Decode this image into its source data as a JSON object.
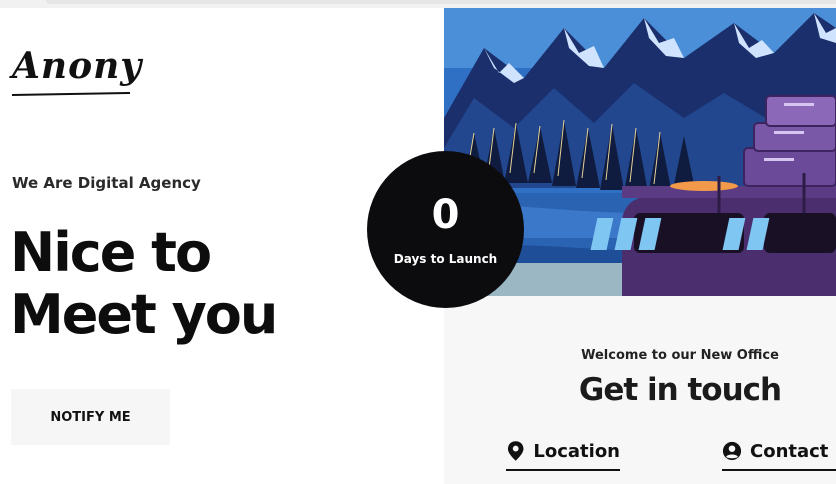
{
  "brand": {
    "logo_text": "Anony"
  },
  "hero": {
    "tagline": "We Are Digital Agency",
    "headline_line1": "Nice to",
    "headline_line2": "Meet you",
    "notify_label": "NOTIFY ME"
  },
  "countdown": {
    "value": "0",
    "label": "Days to Launch"
  },
  "contact_section": {
    "welcome": "Welcome to our New Office",
    "title": "Get in touch",
    "tabs": [
      {
        "label": "Location",
        "icon": "map-pin-icon"
      },
      {
        "label": "Contact",
        "icon": "user-circle-icon"
      }
    ]
  },
  "colors": {
    "dark": "#0c0c0f",
    "mountain_blue": "#1f3f8a",
    "sky": "#2f6fc4",
    "van_purple": "#4a2e6e",
    "accent_orange": "#f2994a"
  }
}
